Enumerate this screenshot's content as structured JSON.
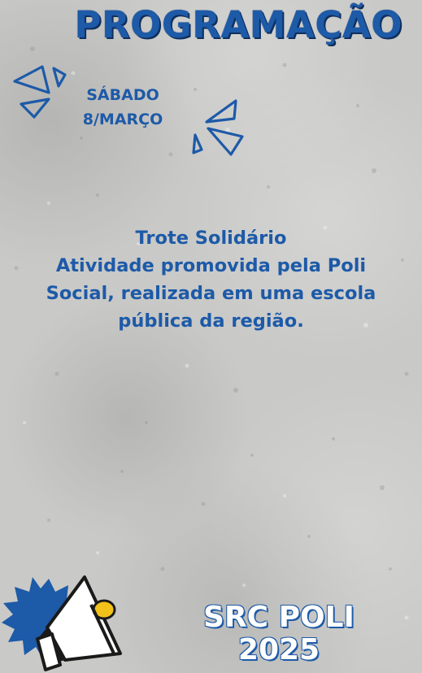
{
  "header": {
    "title": "PROGRAMAÇÃO",
    "day": "SÁBADO",
    "date": "8/MARÇO"
  },
  "event": {
    "lines": [
      "Trote Solidário",
      "Atividade promovida pela Poli",
      "Social, realizada em uma escola",
      "pública da região."
    ]
  },
  "footer": {
    "brand_line1": "SRC POLI",
    "brand_line2": "2025"
  },
  "colors": {
    "accent": "#1d5aa8",
    "background": "#c9c9c7",
    "megaphone_body": "#ffffff",
    "megaphone_outline": "#1a1a1a",
    "megaphone_accent": "#f2c21b"
  },
  "icons": [
    "triangle-burst-left-icon",
    "triangle-burst-right-icon",
    "megaphone-icon",
    "starburst-icon"
  ]
}
